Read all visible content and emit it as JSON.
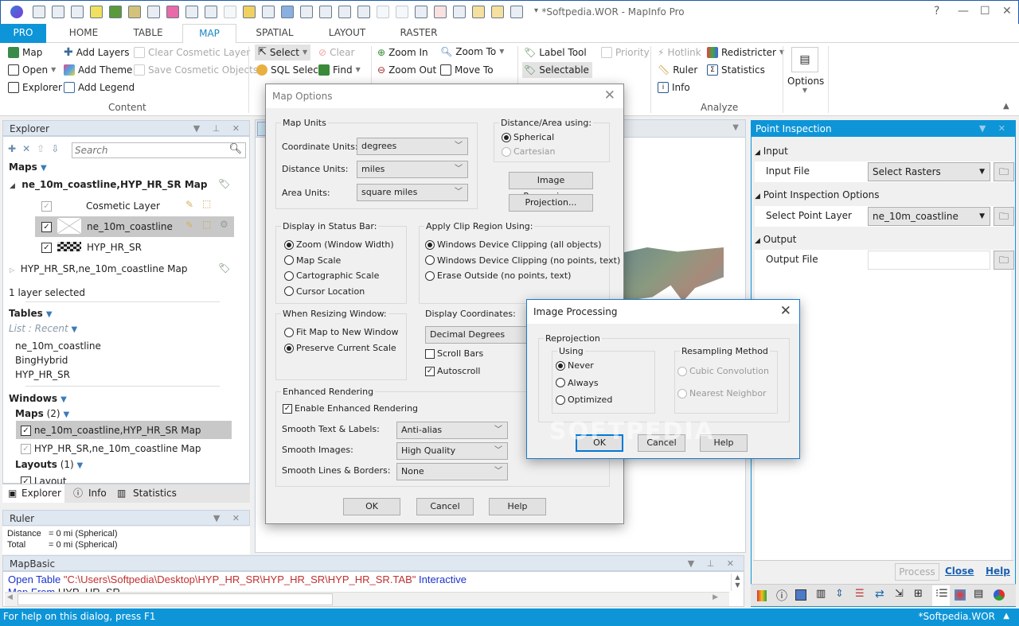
{
  "window": {
    "title": "*Softpedia.WOR - MapInfo Pro",
    "controls": [
      "?",
      "—",
      "☐",
      "✕"
    ]
  },
  "ribbon_tabs": [
    {
      "label": "PRO",
      "state": "pro"
    },
    {
      "label": "HOME"
    },
    {
      "label": "TABLE"
    },
    {
      "label": "MAP",
      "state": "active"
    },
    {
      "label": "SPATIAL"
    },
    {
      "label": "LAYOUT"
    },
    {
      "label": "RASTER"
    }
  ],
  "ribbon": {
    "content": {
      "map": "Map",
      "open": "Open",
      "explorer": "Explorer",
      "add_layers": "Add Layers",
      "add_theme": "Add Theme",
      "add_legend": "Add Legend",
      "clear_cosmetic": "Clear Cosmetic Layer",
      "save_cosmetic": "Save Cosmetic Objects",
      "group": "Content"
    },
    "selection": {
      "select": "Select",
      "clear": "Clear",
      "sql_select": "SQL Select",
      "find": "Find"
    },
    "navigate": {
      "zoom_in": "Zoom In",
      "zoom_out": "Zoom Out",
      "zoom_to": "Zoom To",
      "move_to": "Move To"
    },
    "labels": {
      "label_tool": "Label Tool",
      "selectable": "Selectable",
      "priority": "Priority"
    },
    "analyze": {
      "hotlink": "Hotlink",
      "redistricter": "Redistricter",
      "ruler": "Ruler",
      "statistics": "Statistics",
      "info": "Info",
      "group": "Analyze"
    },
    "options": "Options"
  },
  "explorer": {
    "title": "Explorer",
    "search_placeholder": "Search",
    "maps_heading": "Maps",
    "map1": {
      "name": "ne_10m_coastline,HYP_HR_SR Map",
      "layers": [
        "Cosmetic Layer",
        "ne_10m_coastline",
        "HYP_HR_SR"
      ]
    },
    "map2": "HYP_HR_SR,ne_10m_coastline Map",
    "selection_status": "1 layer selected",
    "tables_heading": "Tables",
    "list_mode": "List : Recent",
    "tables": [
      "ne_10m_coastline",
      "BingHybrid",
      "HYP_HR_SR"
    ],
    "windows_heading": "Windows",
    "maps_sub": "Maps",
    "maps_count": "(2)",
    "window_maps": [
      "ne_10m_coastline,HYP_HR_SR Map",
      "HYP_HR_SR,ne_10m_coastline Map"
    ],
    "layouts_sub": "Layouts",
    "layouts_count": "(1)",
    "layout_item": "Layout",
    "bottom_tabs": [
      "Explorer",
      "Info",
      "Statistics"
    ]
  },
  "ruler": {
    "title": "Ruler",
    "distance_label": "Distance",
    "distance_value": "= 0 mi (Spherical)",
    "total_label": "Total",
    "total_value": "= 0 mi (Spherical)"
  },
  "mapbasic": {
    "title": "MapBasic",
    "line1_keyword": "Open Table",
    "line1_path": "\"C:\\Users\\Softpedia\\Desktop\\HYP_HR_SR\\HYP_HR_SR\\HYP_HR_SR.TAB\"",
    "line1_tail": "Interactive",
    "line2_keyword": "Map From",
    "line2_value": "HYP_HR_SR"
  },
  "point_inspection": {
    "title": "Point Inspection",
    "input_section": "Input",
    "input_file_label": "Input File",
    "input_file_value": "Select Rasters",
    "options_section": "Point Inspection Options",
    "point_layer_label": "Select Point Layer",
    "point_layer_value": "ne_10m_coastline",
    "output_section": "Output",
    "output_file_label": "Output File",
    "output_file_value": "",
    "process": "Process",
    "close": "Close",
    "help": "Help"
  },
  "map_options": {
    "title": "Map Options",
    "map_units": "Map Units",
    "coordinate_units_label": "Coordinate Units:",
    "coordinate_units": "degrees",
    "distance_units_label": "Distance Units:",
    "distance_units": "miles",
    "area_units_label": "Area Units:",
    "area_units": "square miles",
    "distance_area_using": "Distance/Area using:",
    "spherical": "Spherical",
    "cartesian": "Cartesian",
    "image_processing_btn": "Image Processing...",
    "projection_btn": "Projection...",
    "status_bar_group": "Display in Status Bar:",
    "status_options": [
      "Zoom (Window Width)",
      "Map Scale",
      "Cartographic Scale",
      "Cursor Location"
    ],
    "status_selected": 0,
    "clip_group": "Apply Clip Region Using:",
    "clip_options": [
      "Windows Device Clipping (all objects)",
      "Windows Device Clipping (no points, text)",
      "Erase Outside (no points, text)"
    ],
    "clip_selected": 0,
    "resize_group": "When Resizing Window:",
    "resize_options": [
      "Fit Map to New Window",
      "Preserve Current Scale"
    ],
    "resize_selected": 1,
    "display_coords_label": "Display Coordinates:",
    "display_coords": "Decimal Degrees",
    "scroll_bars": "Scroll Bars",
    "scroll_bars_checked": false,
    "autoscroll": "Autoscroll",
    "autoscroll_checked": true,
    "enhanced_group": "Enhanced Rendering",
    "enable_enhanced": "Enable Enhanced Rendering",
    "enable_enhanced_checked": true,
    "smooth_text_label": "Smooth Text & Labels:",
    "smooth_text": "Anti-alias",
    "smooth_images_label": "Smooth Images:",
    "smooth_images": "High Quality",
    "smooth_lines_label": "Smooth Lines & Borders:",
    "smooth_lines": "None",
    "ok": "OK",
    "cancel": "Cancel",
    "help": "Help"
  },
  "image_processing": {
    "title": "Image Processing",
    "reprojection": "Reprojection",
    "using": "Using",
    "using_options": [
      "Never",
      "Always",
      "Optimized"
    ],
    "using_selected": 0,
    "resampling": "Resampling Method",
    "resampling_options": [
      "Cubic Convolution",
      "Nearest Neighbor"
    ],
    "ok": "OK",
    "cancel": "Cancel",
    "help": "Help"
  },
  "status_bar": {
    "help_text": "For help on this dialog, press F1",
    "workspace": "*Softpedia.WOR"
  },
  "watermark": "SOFTPEDIA"
}
